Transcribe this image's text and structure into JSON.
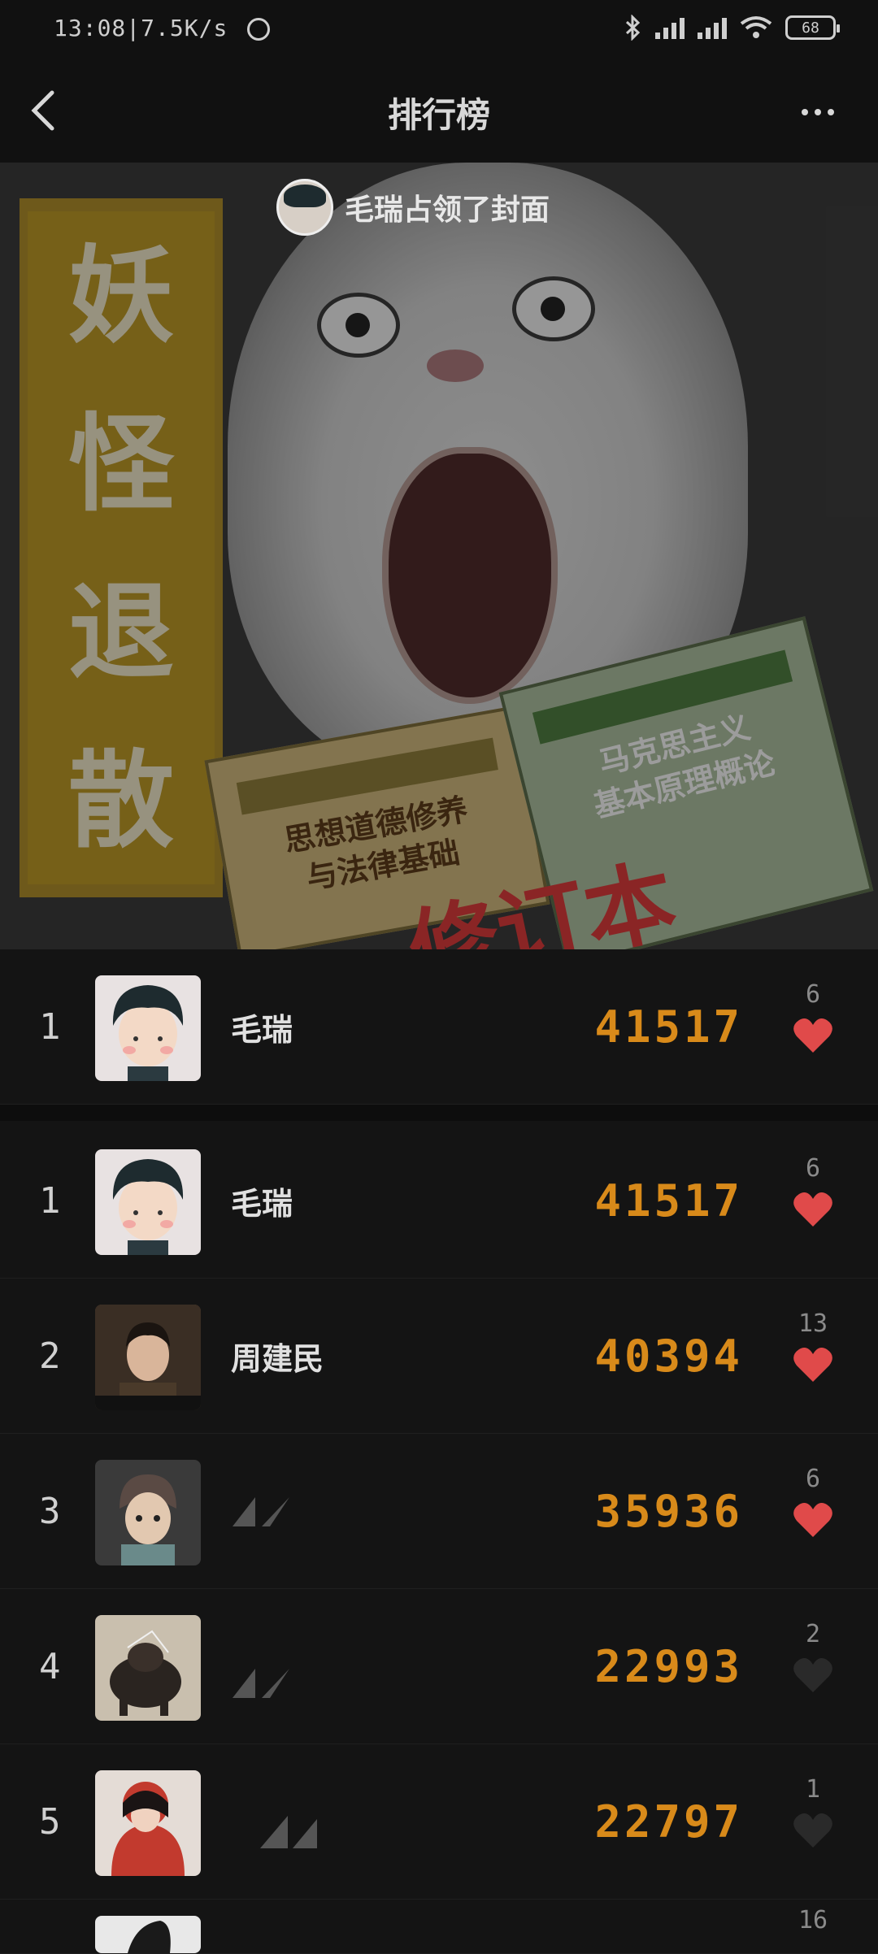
{
  "status_bar": {
    "time": "13:08",
    "speed": "7.5K/s",
    "battery": "68"
  },
  "header": {
    "title": "排行榜"
  },
  "cover": {
    "caption": "毛瑞占领了封面",
    "banner_text": [
      "妖",
      "怪",
      "退",
      "散"
    ],
    "book_left": [
      "思想道德修养",
      "与法律基础"
    ],
    "book_right": [
      "马克思主义",
      "基本原理概论"
    ],
    "sticker_text": "修订本"
  },
  "my_rank": {
    "rank": "1",
    "name": "毛瑞",
    "score": "41517",
    "likes": "6",
    "liked": true
  },
  "leaderboard": [
    {
      "rank": "1",
      "name": "毛瑞",
      "score": "41517",
      "likes": "6",
      "liked": true
    },
    {
      "rank": "2",
      "name": "周建民",
      "score": "40394",
      "likes": "13",
      "liked": true
    },
    {
      "rank": "3",
      "name": "",
      "score": "35936",
      "likes": "6",
      "liked": true
    },
    {
      "rank": "4",
      "name": "",
      "score": "22993",
      "likes": "2",
      "liked": false
    },
    {
      "rank": "5",
      "name": "",
      "score": "22797",
      "likes": "1",
      "liked": false
    },
    {
      "rank": "",
      "name": "",
      "score": "",
      "likes": "16",
      "liked": false
    }
  ],
  "colors": {
    "score": "#d88a1a",
    "heart_active": "#e04a4a",
    "heart_inactive": "#2a2a2a",
    "background": "#141414"
  }
}
